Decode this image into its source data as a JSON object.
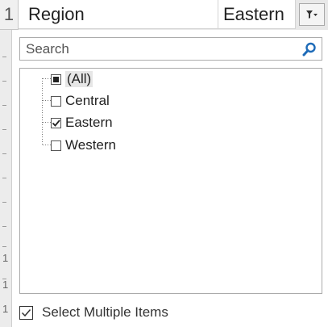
{
  "sheet": {
    "row_number": "1",
    "row_numbers_left": [
      "1",
      "1",
      "1"
    ],
    "header_cell": "Region",
    "filter_cell": "Eastern",
    "filter_button_icon": "filter-dropdown-icon"
  },
  "search": {
    "placeholder": "Search",
    "value": "",
    "icon": "search-icon"
  },
  "tree": {
    "items": [
      {
        "label": "(All)",
        "state": "mixed"
      },
      {
        "label": "Central",
        "state": "unchecked"
      },
      {
        "label": "Eastern",
        "state": "checked"
      },
      {
        "label": "Western",
        "state": "unchecked"
      }
    ]
  },
  "options": {
    "select_multiple_label": "Select Multiple Items",
    "select_multiple_checked": true
  },
  "colors": {
    "search_icon": "#1e6bb8",
    "border": "#ababab",
    "highlight": "#e6e6e6"
  }
}
